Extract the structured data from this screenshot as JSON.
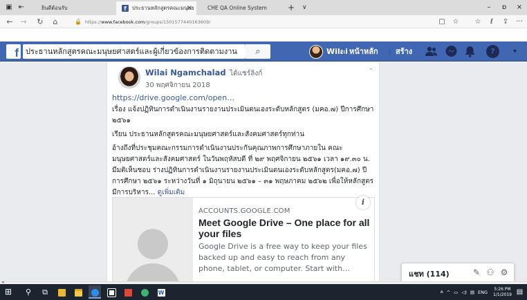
{
  "browser": {
    "tabs": [
      {
        "label": "ยินดีต้อนรับ",
        "active": false
      },
      {
        "label": "ประธานหลักสูตรคณะมนุษย",
        "active": true,
        "favicon": "f"
      },
      {
        "label": "CHE QA Online System",
        "active": false
      }
    ],
    "new_tab_symbol": "+",
    "tab_list_symbol": "∨",
    "tab_close_symbol": "×",
    "window_controls": {
      "minimize": "–",
      "maximize": "ɒ",
      "close": "×"
    },
    "nav": {
      "back": "←",
      "forward": "→",
      "refresh": "↻",
      "home": "⌂"
    },
    "address": {
      "lock": "🔒",
      "prefix": "https://",
      "domain": "www.facebook.com",
      "path": "/groups/1501577440163609/"
    },
    "toolbar": {
      "reading_view": "▢",
      "favorite": "☆",
      "favorites_hub": "☆",
      "pen": "ℓ",
      "share": "⇪",
      "more": "···"
    }
  },
  "facebook": {
    "logo": "f",
    "search_value": "ประธานหลักสูตรคณะมนุษยศาสตร์และผู้เกี่ยวข้องการติดตามงาน",
    "search_icon": "⌕",
    "user_name": "Wilai",
    "nav_home": "หน้าหลัก",
    "nav_create": "สร้าง",
    "icons": {
      "friends": "friends-icon",
      "messenger": "messenger-icon",
      "notifications": "bell-icon",
      "help": "help-icon",
      "menu": "caret-down-icon"
    },
    "help_glyph": "?",
    "caret_glyph": "▾"
  },
  "post": {
    "author": "Wilai Ngamchalad",
    "author_suffix": "ได้แชร์ลิงก์",
    "date": "30 พฤศจิกายน 2018",
    "options_glyph": "⌄",
    "link": "https://drive.google.com/open…",
    "lines": [
      "เรื่อง แจ้งปฏิทินการดำเนินงานรายงานประเมินตนเองระดับหลักสูตร (มคอ.๗) ปีการศึกษา ๒๕๖๑",
      "เรียน ประธานหลักสูตรคณะมนุษยศาสตร์และสังคมศาสตร์ทุกท่าน",
      "อ้างถึงที่ประชุมคณะกรรมการดำเนินงานประกันคุณภาพการศึกษาภายใน คณะมนุษยศาสตร์และสังคมศาสตร์ ในวันพฤหัสบดี ที่ ๒๙ พฤศจิกายน ๒๕๖๑ เวลา ๑๙.๓๐ น. มีมติเห็นชอบ ร่างปฏิทินการดำเนินงานรายงานประเมินตนเองระดับหลักสูตร(มคอ.๗) ปีการศึกษา ๒๕๖๑ ระหว่างวันที่ ๑ มิถุนายน ๒๕๖๑ – ๓๑ พฤษภาคม ๒๕๖๒ เพื่อให้หลักสูตรมีการบริหาร..."
    ],
    "see_more": "ดูเพิ่มเติม",
    "preview": {
      "domain": "ACCOUNTS.GOOGLE.COM",
      "title": "Meet Google Drive – One place for all your files",
      "description": "Google Drive is a free way to keep your files backed up and easy to reach from any phone, tablet, or computer. Start with…",
      "info_glyph": "i"
    }
  },
  "chat": {
    "label": "แชท (114)",
    "icons": {
      "compose": "✎",
      "new_group": "⚇",
      "settings": "⚙"
    }
  },
  "taskbar": {
    "start": "⊞",
    "search": "⚲",
    "task_view": "⧉",
    "tray": {
      "user": "ጸ",
      "up": "^",
      "battery": "▭",
      "volume": "◁)",
      "network": "▤",
      "lang": "ENG"
    },
    "clock_time": "5:26 PM",
    "clock_date": "1/1/2019",
    "notification": "▤"
  },
  "colors": {
    "fb_blue": "#4267b2",
    "link": "#385898",
    "taskbar": "#1c2430"
  }
}
